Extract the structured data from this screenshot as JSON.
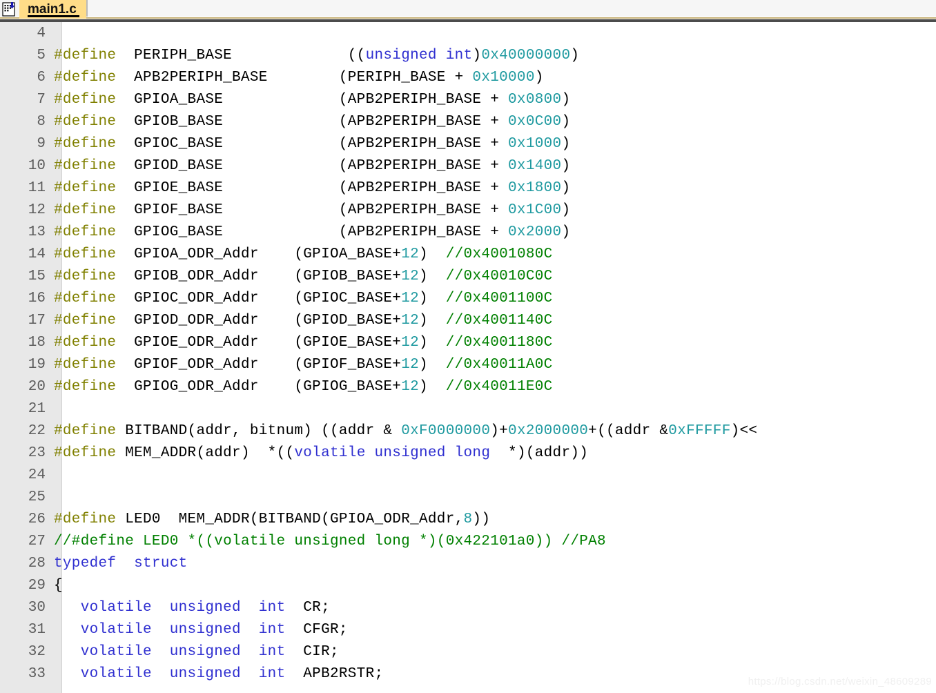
{
  "window": {
    "title": "main1.c"
  },
  "tabbar": {
    "icon": "c-source-file-icon",
    "active_tab": "main1.c"
  },
  "editor": {
    "first_line": 4,
    "watermark": "https://blog.csdn.net/weixin_48609289",
    "colors": {
      "preprocessor": "#808000",
      "keyword": "#3030d0",
      "number": "#1f9aa0",
      "comment": "#008000",
      "text": "#000000",
      "gutter_bg": "#e8e8e8",
      "tab_bg": "#ffdd88",
      "editor_bg": "#ffffff"
    },
    "lines": [
      {
        "n": 4,
        "tokens": []
      },
      {
        "n": 5,
        "tokens": [
          {
            "c": "pp",
            "t": "#define"
          },
          {
            "c": "txt",
            "t": "  PERIPH_BASE             (("
          },
          {
            "c": "kw",
            "t": "unsigned int"
          },
          {
            "c": "txt",
            "t": ")"
          },
          {
            "c": "num",
            "t": "0x40000000"
          },
          {
            "c": "txt",
            "t": ")"
          }
        ]
      },
      {
        "n": 6,
        "tokens": [
          {
            "c": "pp",
            "t": "#define"
          },
          {
            "c": "txt",
            "t": "  APB2PERIPH_BASE        (PERIPH_BASE + "
          },
          {
            "c": "num",
            "t": "0x10000"
          },
          {
            "c": "txt",
            "t": ")"
          }
        ]
      },
      {
        "n": 7,
        "tokens": [
          {
            "c": "pp",
            "t": "#define"
          },
          {
            "c": "txt",
            "t": "  GPIOA_BASE             (APB2PERIPH_BASE + "
          },
          {
            "c": "num",
            "t": "0x0800"
          },
          {
            "c": "txt",
            "t": ")"
          }
        ]
      },
      {
        "n": 8,
        "tokens": [
          {
            "c": "pp",
            "t": "#define"
          },
          {
            "c": "txt",
            "t": "  GPIOB_BASE             (APB2PERIPH_BASE + "
          },
          {
            "c": "num",
            "t": "0x0C00"
          },
          {
            "c": "txt",
            "t": ")"
          }
        ]
      },
      {
        "n": 9,
        "tokens": [
          {
            "c": "pp",
            "t": "#define"
          },
          {
            "c": "txt",
            "t": "  GPIOC_BASE             (APB2PERIPH_BASE + "
          },
          {
            "c": "num",
            "t": "0x1000"
          },
          {
            "c": "txt",
            "t": ")"
          }
        ]
      },
      {
        "n": 10,
        "tokens": [
          {
            "c": "pp",
            "t": "#define"
          },
          {
            "c": "txt",
            "t": "  GPIOD_BASE             (APB2PERIPH_BASE + "
          },
          {
            "c": "num",
            "t": "0x1400"
          },
          {
            "c": "txt",
            "t": ")"
          }
        ]
      },
      {
        "n": 11,
        "tokens": [
          {
            "c": "pp",
            "t": "#define"
          },
          {
            "c": "txt",
            "t": "  GPIOE_BASE             (APB2PERIPH_BASE + "
          },
          {
            "c": "num",
            "t": "0x1800"
          },
          {
            "c": "txt",
            "t": ")"
          }
        ]
      },
      {
        "n": 12,
        "tokens": [
          {
            "c": "pp",
            "t": "#define"
          },
          {
            "c": "txt",
            "t": "  GPIOF_BASE             (APB2PERIPH_BASE + "
          },
          {
            "c": "num",
            "t": "0x1C00"
          },
          {
            "c": "txt",
            "t": ")"
          }
        ]
      },
      {
        "n": 13,
        "tokens": [
          {
            "c": "pp",
            "t": "#define"
          },
          {
            "c": "txt",
            "t": "  GPIOG_BASE             (APB2PERIPH_BASE + "
          },
          {
            "c": "num",
            "t": "0x2000"
          },
          {
            "c": "txt",
            "t": ")"
          }
        ]
      },
      {
        "n": 14,
        "tokens": [
          {
            "c": "pp",
            "t": "#define"
          },
          {
            "c": "txt",
            "t": "  GPIOA_ODR_Addr    (GPIOA_BASE+"
          },
          {
            "c": "num",
            "t": "12"
          },
          {
            "c": "txt",
            "t": ")  "
          },
          {
            "c": "cmt",
            "t": "//0x4001080C"
          }
        ]
      },
      {
        "n": 15,
        "tokens": [
          {
            "c": "pp",
            "t": "#define"
          },
          {
            "c": "txt",
            "t": "  GPIOB_ODR_Addr    (GPIOB_BASE+"
          },
          {
            "c": "num",
            "t": "12"
          },
          {
            "c": "txt",
            "t": ")  "
          },
          {
            "c": "cmt",
            "t": "//0x40010C0C"
          }
        ]
      },
      {
        "n": 16,
        "tokens": [
          {
            "c": "pp",
            "t": "#define"
          },
          {
            "c": "txt",
            "t": "  GPIOC_ODR_Addr    (GPIOC_BASE+"
          },
          {
            "c": "num",
            "t": "12"
          },
          {
            "c": "txt",
            "t": ")  "
          },
          {
            "c": "cmt",
            "t": "//0x4001100C"
          }
        ]
      },
      {
        "n": 17,
        "tokens": [
          {
            "c": "pp",
            "t": "#define"
          },
          {
            "c": "txt",
            "t": "  GPIOD_ODR_Addr    (GPIOD_BASE+"
          },
          {
            "c": "num",
            "t": "12"
          },
          {
            "c": "txt",
            "t": ")  "
          },
          {
            "c": "cmt",
            "t": "//0x4001140C"
          }
        ]
      },
      {
        "n": 18,
        "tokens": [
          {
            "c": "pp",
            "t": "#define"
          },
          {
            "c": "txt",
            "t": "  GPIOE_ODR_Addr    (GPIOE_BASE+"
          },
          {
            "c": "num",
            "t": "12"
          },
          {
            "c": "txt",
            "t": ")  "
          },
          {
            "c": "cmt",
            "t": "//0x4001180C"
          }
        ]
      },
      {
        "n": 19,
        "tokens": [
          {
            "c": "pp",
            "t": "#define"
          },
          {
            "c": "txt",
            "t": "  GPIOF_ODR_Addr    (GPIOF_BASE+"
          },
          {
            "c": "num",
            "t": "12"
          },
          {
            "c": "txt",
            "t": ")  "
          },
          {
            "c": "cmt",
            "t": "//0x40011A0C"
          }
        ]
      },
      {
        "n": 20,
        "tokens": [
          {
            "c": "pp",
            "t": "#define"
          },
          {
            "c": "txt",
            "t": "  GPIOG_ODR_Addr    (GPIOG_BASE+"
          },
          {
            "c": "num",
            "t": "12"
          },
          {
            "c": "txt",
            "t": ")  "
          },
          {
            "c": "cmt",
            "t": "//0x40011E0C"
          }
        ]
      },
      {
        "n": 21,
        "tokens": []
      },
      {
        "n": 22,
        "tokens": [
          {
            "c": "pp",
            "t": "#define"
          },
          {
            "c": "txt",
            "t": " BITBAND(addr, bitnum) ((addr & "
          },
          {
            "c": "num",
            "t": "0xF0000000"
          },
          {
            "c": "txt",
            "t": ")+"
          },
          {
            "c": "num",
            "t": "0x2000000"
          },
          {
            "c": "txt",
            "t": "+((addr &"
          },
          {
            "c": "num",
            "t": "0xFFFFF"
          },
          {
            "c": "txt",
            "t": ")<<"
          }
        ]
      },
      {
        "n": 23,
        "tokens": [
          {
            "c": "pp",
            "t": "#define"
          },
          {
            "c": "txt",
            "t": " MEM_ADDR(addr)  *(("
          },
          {
            "c": "kw",
            "t": "volatile unsigned long"
          },
          {
            "c": "txt",
            "t": "  *)(addr))"
          }
        ]
      },
      {
        "n": 24,
        "tokens": []
      },
      {
        "n": 25,
        "tokens": []
      },
      {
        "n": 26,
        "tokens": [
          {
            "c": "pp",
            "t": "#define"
          },
          {
            "c": "txt",
            "t": " LED0  MEM_ADDR(BITBAND(GPIOA_ODR_Addr,"
          },
          {
            "c": "num",
            "t": "8"
          },
          {
            "c": "txt",
            "t": "))"
          }
        ]
      },
      {
        "n": 27,
        "tokens": [
          {
            "c": "cmt",
            "t": "//#define LED0 *((volatile unsigned long *)(0x422101a0)) //PA8"
          }
        ]
      },
      {
        "n": 28,
        "tokens": [
          {
            "c": "kw",
            "t": "typedef  struct"
          }
        ]
      },
      {
        "n": 29,
        "tokens": [
          {
            "c": "txt",
            "t": "{"
          }
        ]
      },
      {
        "n": 30,
        "tokens": [
          {
            "c": "txt",
            "t": "   "
          },
          {
            "c": "kw",
            "t": "volatile  unsigned  int"
          },
          {
            "c": "txt",
            "t": "  CR;"
          }
        ]
      },
      {
        "n": 31,
        "tokens": [
          {
            "c": "txt",
            "t": "   "
          },
          {
            "c": "kw",
            "t": "volatile  unsigned  int"
          },
          {
            "c": "txt",
            "t": "  CFGR;"
          }
        ]
      },
      {
        "n": 32,
        "tokens": [
          {
            "c": "txt",
            "t": "   "
          },
          {
            "c": "kw",
            "t": "volatile  unsigned  int"
          },
          {
            "c": "txt",
            "t": "  CIR;"
          }
        ]
      },
      {
        "n": 33,
        "tokens": [
          {
            "c": "txt",
            "t": "   "
          },
          {
            "c": "kw",
            "t": "volatile  unsigned  int"
          },
          {
            "c": "txt",
            "t": "  APB2RSTR;"
          }
        ]
      }
    ]
  }
}
